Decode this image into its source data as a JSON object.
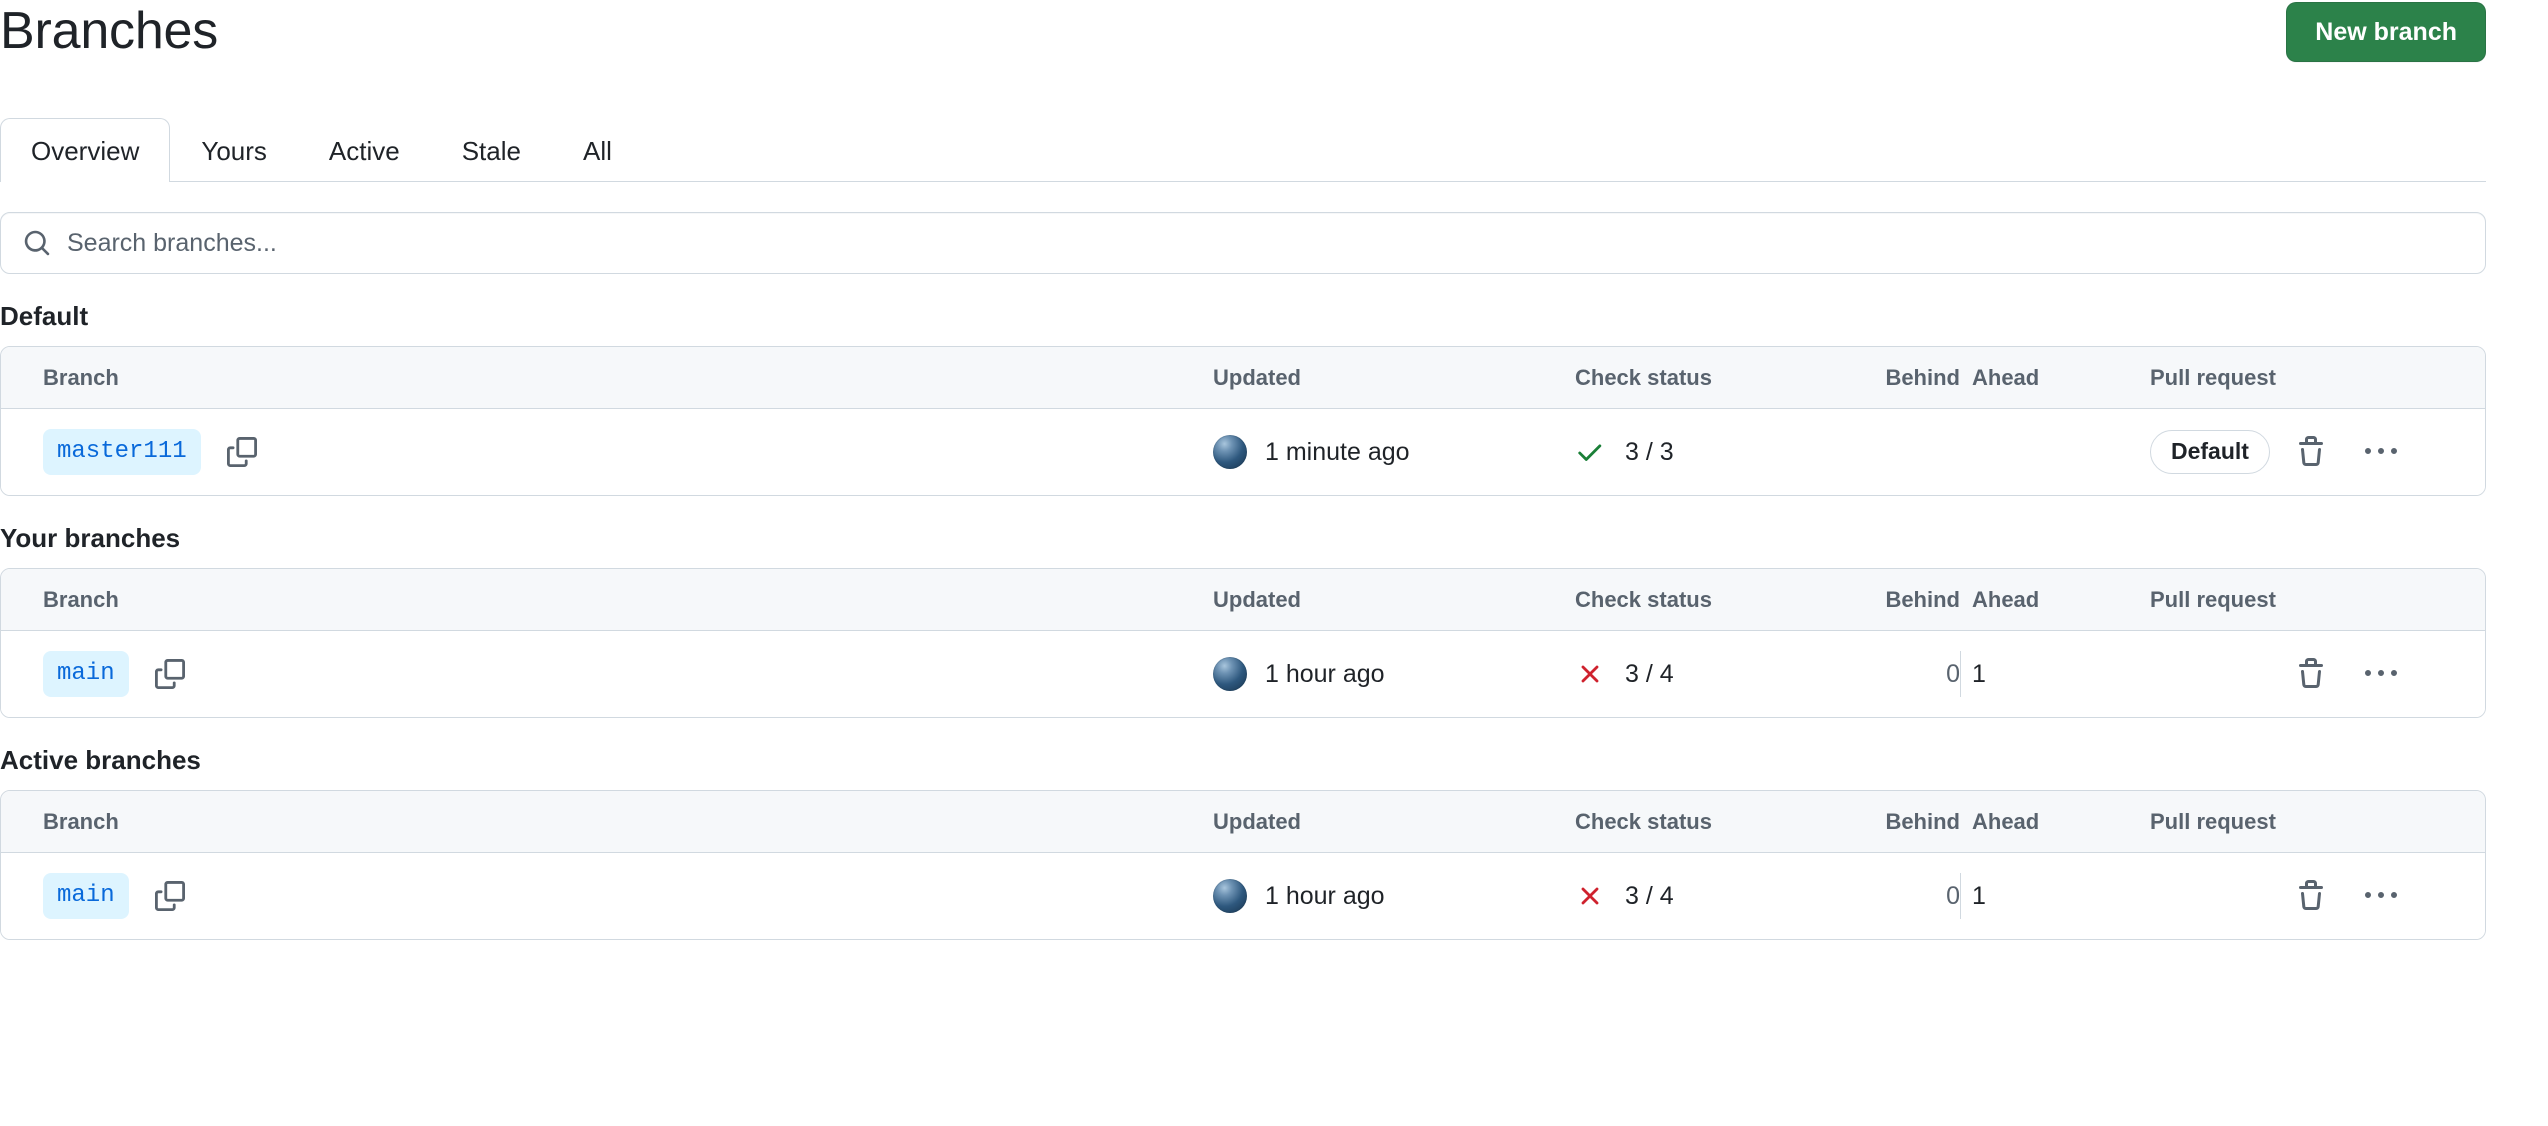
{
  "header": {
    "title": "Branches",
    "new_branch_label": "New branch"
  },
  "tabs": [
    {
      "label": "Overview",
      "selected": true
    },
    {
      "label": "Yours",
      "selected": false
    },
    {
      "label": "Active",
      "selected": false
    },
    {
      "label": "Stale",
      "selected": false
    },
    {
      "label": "All",
      "selected": false
    }
  ],
  "search": {
    "placeholder": "Search branches...",
    "value": ""
  },
  "columns": {
    "branch": "Branch",
    "updated": "Updated",
    "check_status": "Check status",
    "behind": "Behind",
    "ahead": "Ahead",
    "pull_request": "Pull request"
  },
  "sections": [
    {
      "title": "Default",
      "rows": [
        {
          "branch": "master111",
          "updated": "1 minute ago",
          "check_state": "success",
          "check_count": "3 / 3",
          "behind": "",
          "ahead": "",
          "pull_request_badge": "Default",
          "has_divider": false
        }
      ]
    },
    {
      "title": "Your branches",
      "rows": [
        {
          "branch": "main",
          "updated": "1 hour ago",
          "check_state": "failure",
          "check_count": "3 / 4",
          "behind": "0",
          "ahead": "1",
          "pull_request_badge": "",
          "has_divider": true
        }
      ]
    },
    {
      "title": "Active branches",
      "rows": [
        {
          "branch": "main",
          "updated": "1 hour ago",
          "check_state": "failure",
          "check_count": "3 / 4",
          "behind": "0",
          "ahead": "1",
          "pull_request_badge": "",
          "has_divider": true
        }
      ]
    }
  ],
  "icons": {
    "search": "search-icon",
    "copy": "copy-icon",
    "check_success": "check-success-icon",
    "check_failure": "check-failure-icon",
    "delete": "trash-icon",
    "more": "kebab-menu-icon"
  },
  "colors": {
    "accent_green": "#2c824a",
    "branch_pill_bg": "#ddf4ff",
    "branch_pill_text": "#0969da",
    "success": "#1a7f37",
    "failure": "#cf222e",
    "border": "#d1d9e0",
    "header_bg": "#f6f8fa",
    "muted_text": "#59636e"
  }
}
